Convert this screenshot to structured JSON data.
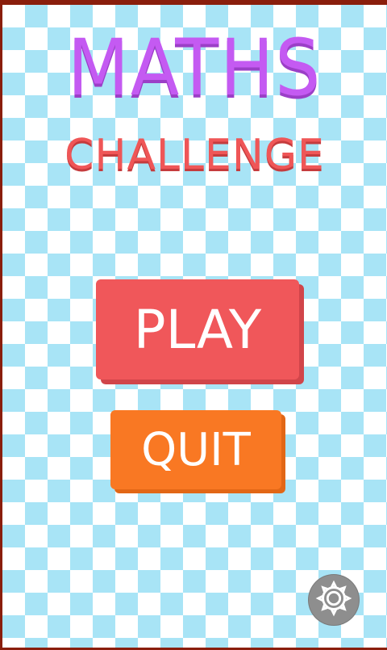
{
  "title": {
    "line1": "MATHS",
    "line2": "CHALLENGE"
  },
  "buttons": {
    "play_label": "PLAY",
    "quit_label": "QUIT"
  },
  "settings": {
    "icon": "gear-icon"
  },
  "colors": {
    "title_line1": "#c45af2",
    "title_line2": "#ef5657",
    "play_button": "#f0575a",
    "quit_button": "#f97823",
    "checker_light_blue": "#a8e4f6",
    "checker_white": "#ffffff",
    "frame": "#8a1e0c",
    "settings_button": "#8e8e8e"
  }
}
